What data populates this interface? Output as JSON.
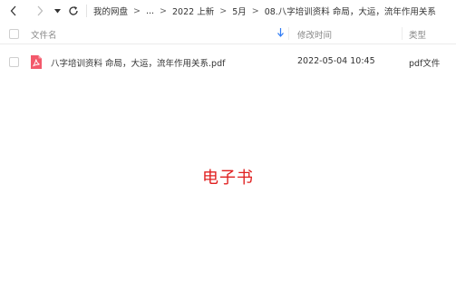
{
  "toolbar": {
    "back_icon": "chevron-left-icon",
    "forward_icon": "chevron-right-icon",
    "dropdown_icon": "caret-down-icon",
    "refresh_icon": "refresh-icon",
    "breadcrumbs": [
      "我的网盘",
      "...",
      "2022 上新",
      "5月",
      "08.八字培训资料  命局，大运，流年作用关系"
    ],
    "separator": ">"
  },
  "columns": {
    "name": "文件名",
    "modified": "修改时间",
    "type": "类型",
    "sort_icon": "sort-down-arrow-icon"
  },
  "files": [
    {
      "icon": "pdf-file-icon",
      "name": "八字培训资料  命局，大运，流年作用关系.pdf",
      "modified": "2022-05-04 10:45",
      "type": "pdf文件"
    }
  ],
  "overlay_text": "电子书",
  "colors": {
    "pdf_red": "#f3596b",
    "overlay_red": "#e02020",
    "sort_blue": "#2f7bf5"
  }
}
